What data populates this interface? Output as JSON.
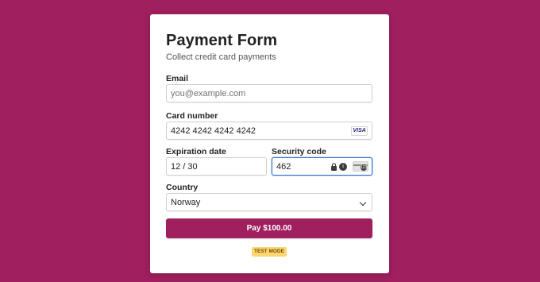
{
  "form": {
    "title": "Payment Form",
    "subtitle": "Collect credit card payments"
  },
  "fields": {
    "email": {
      "label": "Email",
      "placeholder": "you@example.com",
      "value": ""
    },
    "card_number": {
      "label": "Card number",
      "value": "4242 4242 4242 4242",
      "brand": "VISA"
    },
    "expiration": {
      "label": "Expiration date",
      "value": "12 / 30"
    },
    "security_code": {
      "label": "Security code",
      "value": "462"
    },
    "country": {
      "label": "Country",
      "value": "Norway"
    }
  },
  "actions": {
    "pay_label": "Pay $100.00"
  },
  "badge": {
    "test_mode": "TEST MODE"
  },
  "colors": {
    "background": "#a01f5f",
    "button": "#a01f5f",
    "focus_border": "#2f6fd1",
    "badge": "#fbd671"
  },
  "icons": {
    "card_brand": "visa-icon",
    "lock": "lock-icon",
    "info": "info-icon",
    "cvc": "cvc-card-icon",
    "select": "chevron-down-icon"
  }
}
